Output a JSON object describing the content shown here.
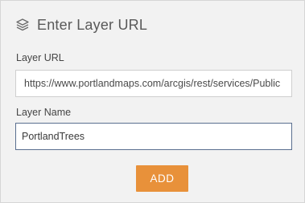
{
  "header": {
    "title": "Enter Layer URL",
    "icon": "layers-icon"
  },
  "form": {
    "url_label": "Layer URL",
    "url_value": "https://www.portlandmaps.com/arcgis/rest/services/Public",
    "name_label": "Layer Name",
    "name_value": "PortlandTrees"
  },
  "actions": {
    "add_label": "ADD"
  },
  "colors": {
    "panel_bg": "#f2f2f2",
    "accent": "#e8913a",
    "focus_border": "#5a6f8f"
  }
}
